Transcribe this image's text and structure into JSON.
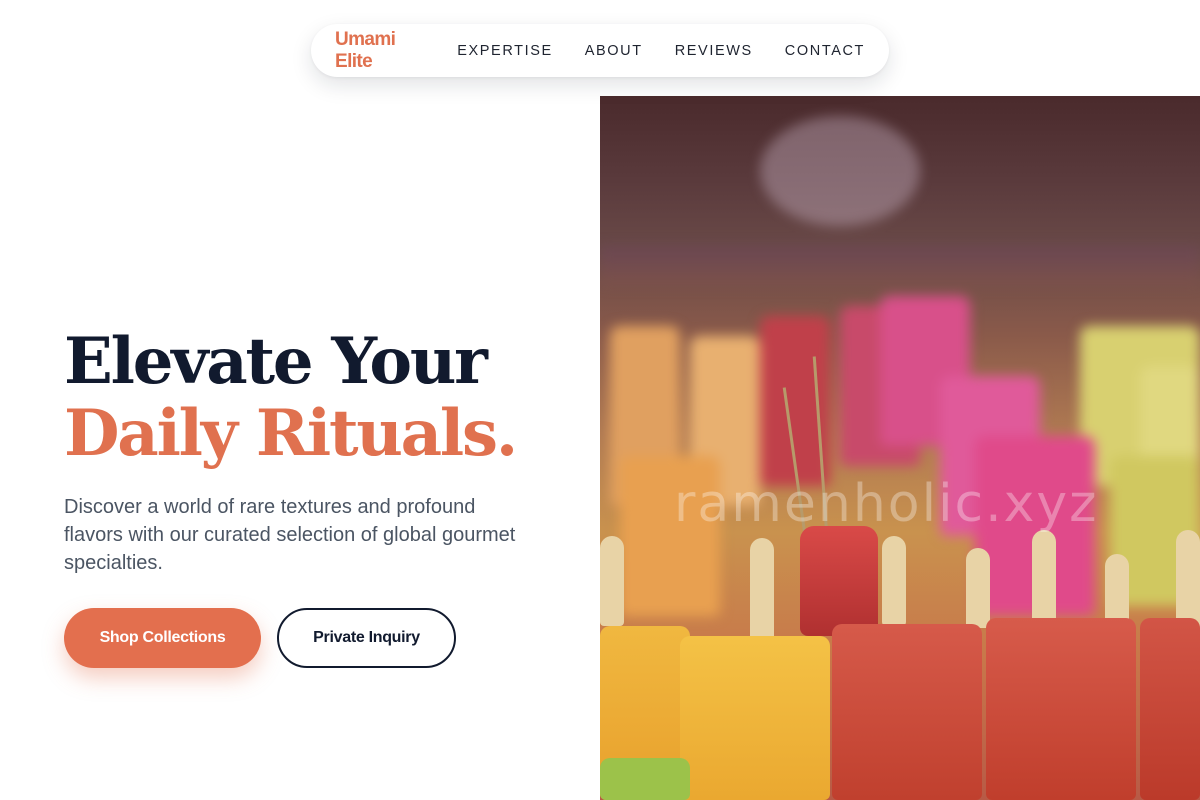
{
  "brand": {
    "name": "Umami Elite",
    "color": "#e0714f"
  },
  "nav": {
    "items": [
      {
        "label": "EXPERTISE"
      },
      {
        "label": "ABOUT"
      },
      {
        "label": "REVIEWS"
      },
      {
        "label": "CONTACT"
      }
    ]
  },
  "hero": {
    "headline_line1": "Elevate Your",
    "headline_line2": "Daily Rituals.",
    "description": "Discover a world of rare textures and profound flavors with our curated selection of global gourmet specialties.",
    "primary_button": "Shop Collections",
    "secondary_button": "Private Inquiry",
    "image_alt": "Rows of colorful fruit popsicles on sticks in a display case",
    "watermark": "ramenholic.xyz"
  },
  "colors": {
    "accent": "#e0714f",
    "heading": "#111a2e",
    "body_text": "#4b5563",
    "primary_button_bg": "#e36f4e"
  }
}
